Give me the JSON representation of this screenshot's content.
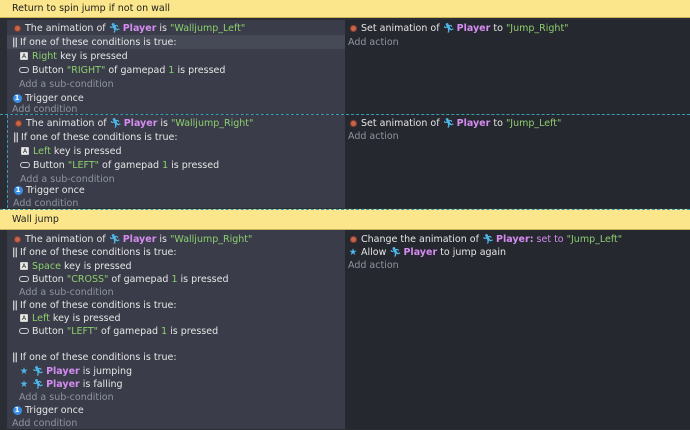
{
  "groups": [
    {
      "comment": "Return to spin jump if not on wall"
    },
    {
      "comment": "Wall jump"
    }
  ],
  "events": [
    {
      "conditions": [
        {
          "type": "anim",
          "pre": "The animation of",
          "obj": "Player",
          "mid": "is",
          "value": "\"Walljump_Left\""
        },
        {
          "type": "or",
          "text": "If one of these conditions is true:"
        },
        {
          "type": "key",
          "value": "Right",
          "rest": "key is pressed"
        },
        {
          "type": "pad",
          "pre": "Button",
          "button": "\"RIGHT\"",
          "mid": "of gamepad",
          "num": "1",
          "rest": "is pressed"
        },
        {
          "type": "addsub",
          "text": "Add a sub-condition"
        },
        {
          "type": "once",
          "text": "Trigger once"
        },
        {
          "type": "add",
          "text": "Add condition"
        }
      ],
      "actions": [
        {
          "pre": "Set animation of",
          "obj": "Player",
          "mid": "to",
          "value": "\"Jump_Right\""
        },
        {
          "add": "Add action"
        }
      ]
    },
    {
      "conditions": [
        {
          "pre": "The animation of",
          "obj": "Player",
          "mid": "is",
          "value": "\"Walljump_Right\""
        },
        {
          "text": "If one of these conditions is true:"
        },
        {
          "value": "Left",
          "rest": "key is pressed"
        },
        {
          "pre": "Button",
          "button": "\"LEFT\"",
          "mid": "of gamepad",
          "num": "1",
          "rest": "is pressed"
        },
        {
          "text": "Add a sub-condition"
        },
        {
          "text": "Trigger once"
        },
        {
          "text": "Add condition"
        }
      ],
      "actions": [
        {
          "pre": "Set animation of",
          "obj": "Player",
          "mid": "to",
          "value": "\"Jump_Left\""
        },
        {
          "add": "Add action"
        }
      ]
    },
    {
      "conditions": [
        {
          "pre": "The animation of",
          "obj": "Player",
          "mid": "is",
          "value": "\"Walljump_Right\""
        },
        {
          "text": "If one of these conditions is true:"
        },
        {
          "value": "Space",
          "rest": "key is pressed"
        },
        {
          "pre": "Button",
          "button": "\"CROSS\"",
          "mid": "of gamepad",
          "num": "1",
          "rest": "is pressed"
        },
        {
          "text": "Add a sub-condition"
        },
        {
          "text": "If one of these conditions is true:"
        },
        {
          "value": "Left",
          "rest": "key is pressed"
        },
        {
          "pre": "Button",
          "button": "\"LEFT\"",
          "mid": "of gamepad",
          "num": "1",
          "rest": "is pressed"
        },
        {
          "text": "If one of these conditions is true:"
        },
        {
          "obj": "Player",
          "rest": "is jumping"
        },
        {
          "obj": "Player",
          "rest": "is falling"
        },
        {
          "text": "Add a sub-condition"
        },
        {
          "text": "Trigger once"
        },
        {
          "text": "Add condition"
        }
      ],
      "actions": [
        {
          "pre": "Change the animation of",
          "obj": "Player:",
          "mid": "set to",
          "value": "\"Jump_Left\""
        },
        {
          "pre": "Allow",
          "obj": "Player",
          "rest": "to jump again"
        },
        {
          "add": "Add action"
        }
      ]
    }
  ],
  "icons": {
    "animation": "animation-dot-icon",
    "key": "keyboard-key-icon",
    "gamepad": "gamepad-icon",
    "once": "trigger-once-icon",
    "object": "player-object-icon",
    "platformer": "platformer-behavior-icon"
  },
  "colors": {
    "comment_bg": "#fbe68c",
    "condition_bg": "#3a3d49",
    "action_bg": "#262830",
    "value_green": "#8ccf6e",
    "object_purple": "#d58cf0",
    "muted": "#8f94a1"
  }
}
